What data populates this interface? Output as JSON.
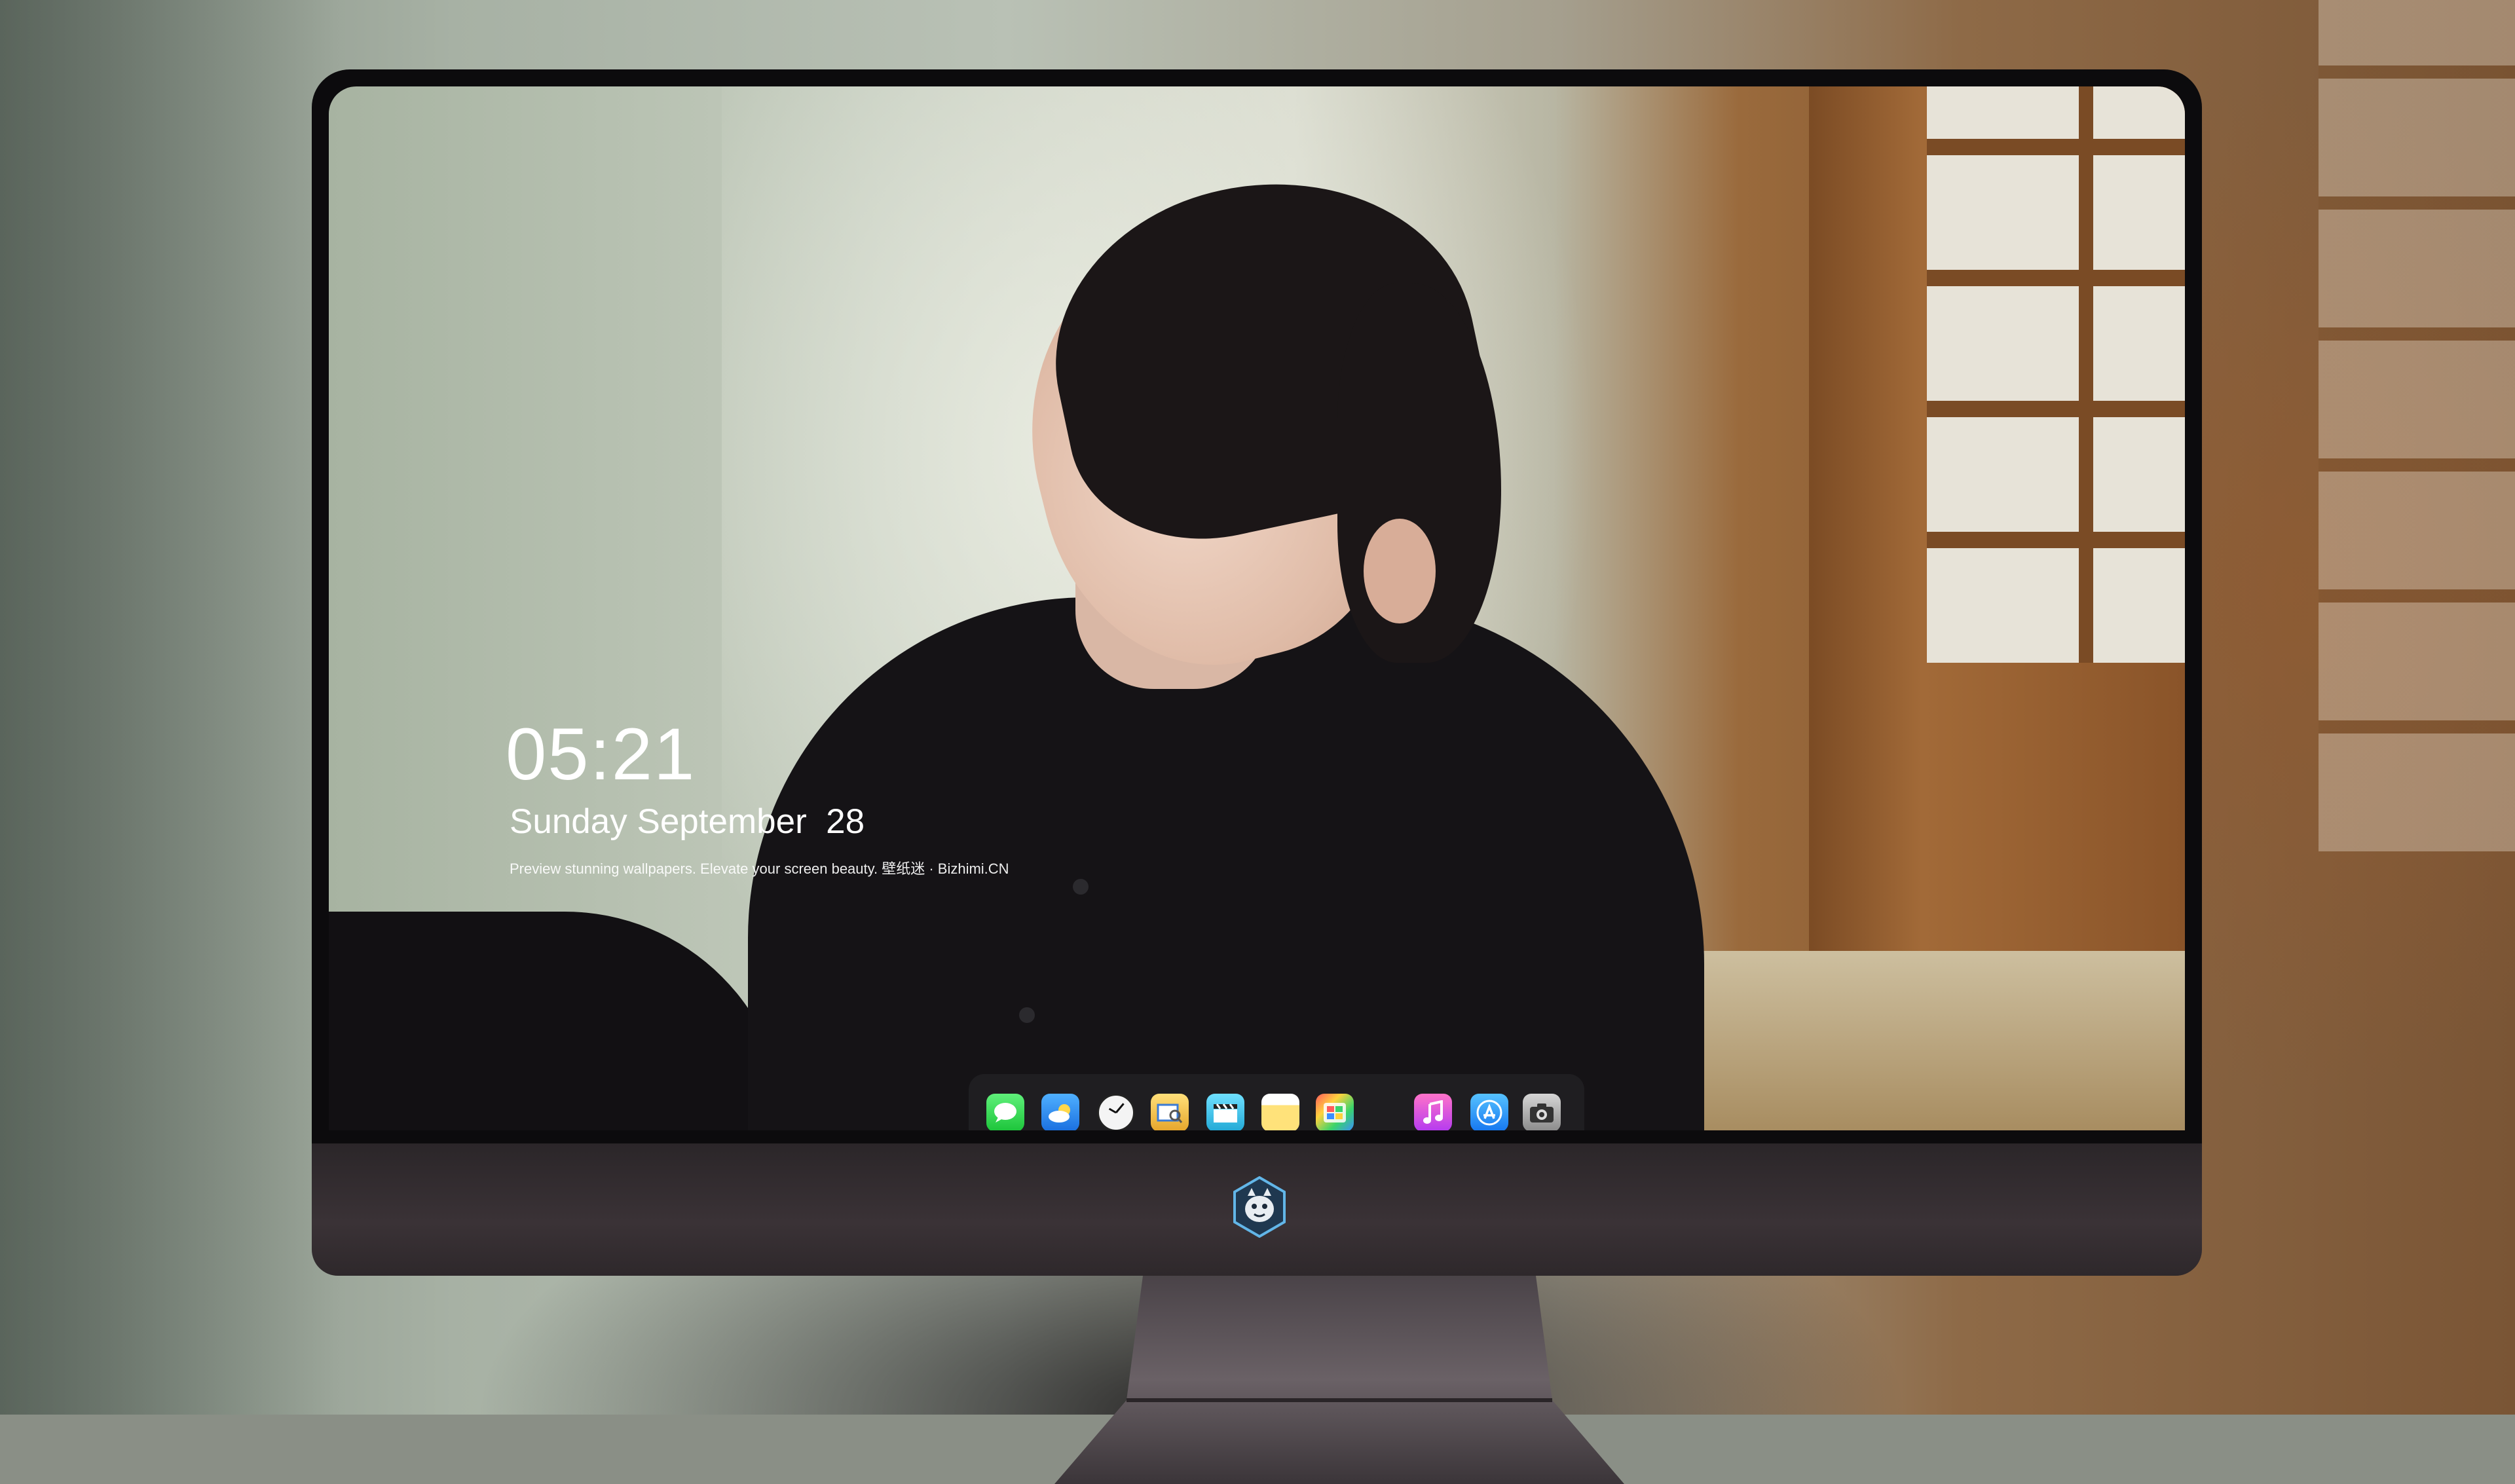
{
  "lockscreen": {
    "time": "05:21",
    "date": "Sunday September  28",
    "tagline": "Preview stunning wallpapers. Elevate your screen beauty. 壁纸迷 · Bizhimi.CN"
  },
  "dock": {
    "items": [
      {
        "name": "messages",
        "icon": "message-bubble-icon"
      },
      {
        "name": "weather",
        "icon": "cloud-icon"
      },
      {
        "name": "clock",
        "icon": "clock-icon"
      },
      {
        "name": "preview",
        "icon": "preview-icon"
      },
      {
        "name": "clips",
        "icon": "clapperboard-icon"
      },
      {
        "name": "notes",
        "icon": "notes-icon"
      },
      {
        "name": "photo-booth",
        "icon": "photos-icon"
      },
      {
        "name": "music",
        "icon": "music-note-icon"
      },
      {
        "name": "app-store",
        "icon": "app-store-icon"
      },
      {
        "name": "camera",
        "icon": "camera-icon"
      }
    ]
  },
  "brand": {
    "logo": "bizhimi-mascot-logo"
  },
  "colors": {
    "bezel": "#0c0b0d",
    "chin": "#332d30",
    "text": "#ffffff"
  }
}
